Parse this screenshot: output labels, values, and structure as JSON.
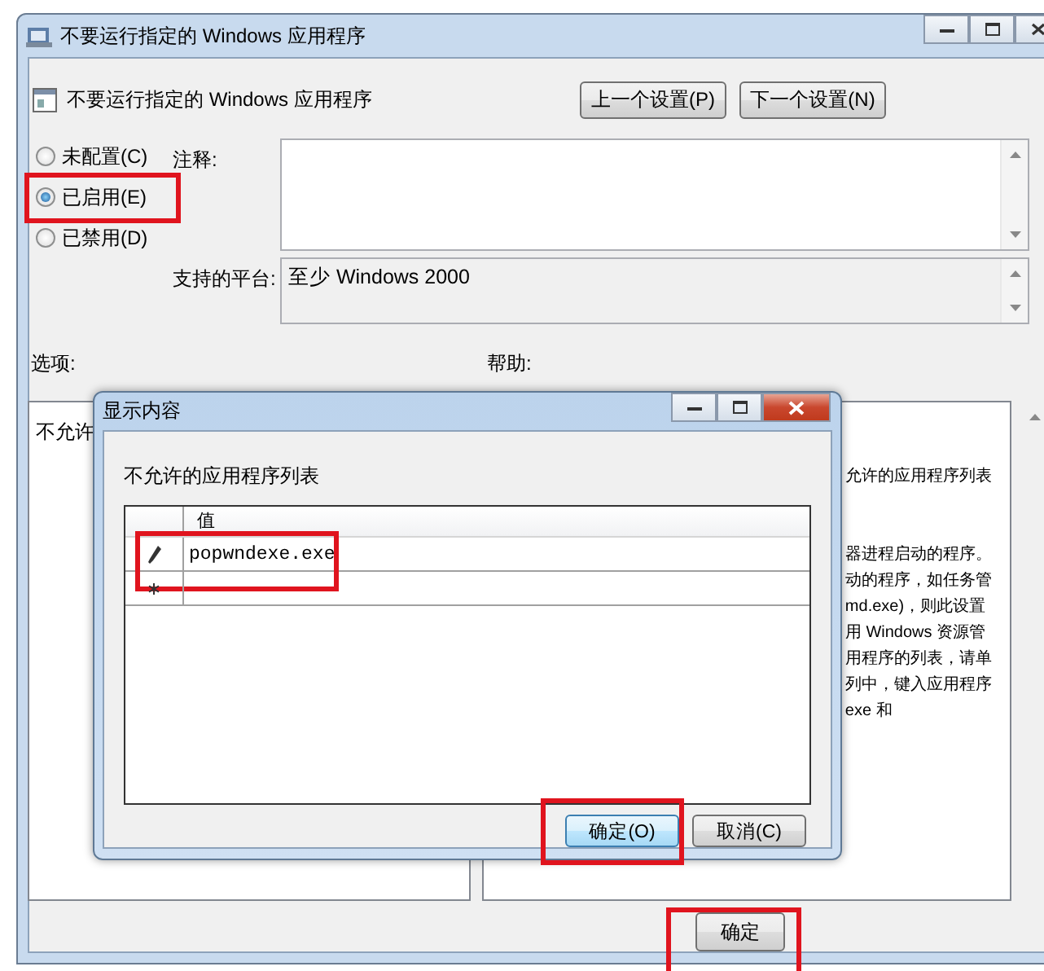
{
  "main_window": {
    "title": "不要运行指定的 Windows 应用程序",
    "policy_name": "不要运行指定的 Windows 应用程序",
    "nav_buttons": [
      "上一个设置(P)",
      "下一个设置(N)"
    ],
    "state_options": [
      {
        "label": "未配置(C)",
        "selected": false,
        "highlighted": false
      },
      {
        "label": "已启用(E)",
        "selected": true,
        "highlighted": true
      },
      {
        "label": "已禁用(D)",
        "selected": false,
        "highlighted": false
      }
    ],
    "comment": {
      "label": "注释:"
    },
    "platform": {
      "label": "支持的平台:",
      "value": "至少 Windows 2000"
    },
    "options": {
      "label": "选项:",
      "text": "不允许"
    },
    "help": {
      "label": "帮助:",
      "intro": "允许的应用程序列表",
      "lines": [
        "器进程启动的程序。",
        "动的程序，如任务管",
        "md.exe)，则此设置",
        "用 Windows 资源管",
        "用程序的列表，请单",
        "列中，键入应用程序",
        "exe 和"
      ]
    },
    "buttons": [
      {
        "label": "确定",
        "highlighted": true
      }
    ]
  },
  "dialog": {
    "title": "显示内容",
    "list_label": "不允许的应用程序列表",
    "column": "值",
    "rows": [
      {
        "kind": "edit",
        "value": "popwndexe.exe",
        "highlighted": true
      },
      {
        "kind": "new",
        "highlighted": false
      }
    ],
    "buttons": [
      {
        "label": "确定(O)",
        "default": true,
        "highlighted": true
      },
      {
        "label": "取消(C)",
        "default": false,
        "highlighted": false
      }
    ]
  }
}
